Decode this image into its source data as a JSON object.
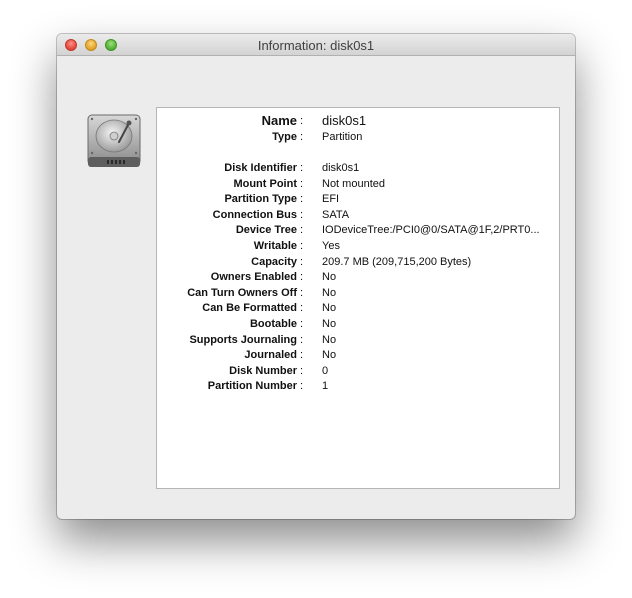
{
  "window": {
    "title": "Information: disk0s1"
  },
  "header": {
    "name_label": "Name",
    "name_value": "disk0s1",
    "type_label": "Type",
    "type_value": "Partition"
  },
  "details": [
    {
      "label": "Disk Identifier",
      "value": "disk0s1"
    },
    {
      "label": "Mount Point",
      "value": "Not mounted"
    },
    {
      "label": "Partition Type",
      "value": "EFI"
    },
    {
      "label": "Connection Bus",
      "value": "SATA"
    },
    {
      "label": "Device Tree",
      "value": "IODeviceTree:/PCI0@0/SATA@1F,2/PRT0..."
    },
    {
      "label": "Writable",
      "value": "Yes"
    },
    {
      "label": "Capacity",
      "value": "209.7 MB (209,715,200 Bytes)"
    },
    {
      "label": "Owners Enabled",
      "value": "No"
    },
    {
      "label": "Can Turn Owners Off",
      "value": "No"
    },
    {
      "label": "Can Be Formatted",
      "value": "No"
    },
    {
      "label": "Bootable",
      "value": "No"
    },
    {
      "label": "Supports Journaling",
      "value": "No"
    },
    {
      "label": "Journaled",
      "value": "No"
    },
    {
      "label": "Disk Number",
      "value": "0"
    },
    {
      "label": "Partition Number",
      "value": "1"
    }
  ],
  "separator": ":",
  "icons": {
    "close": "close-button",
    "minimize": "minimize-button",
    "zoom": "zoom-button",
    "disk": "hard-disk-icon"
  }
}
